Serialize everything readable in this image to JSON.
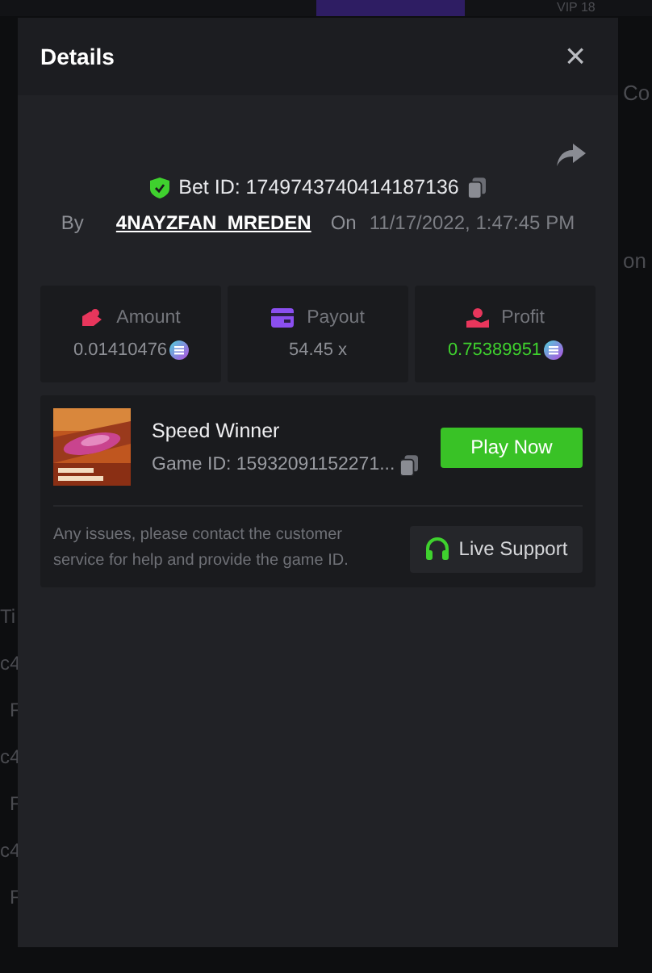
{
  "background": {
    "top_texts": [
      "VIP 18"
    ],
    "right_texts": [
      "Co",
      "on"
    ],
    "left_texts": [
      "Ti",
      "c4",
      "F",
      "c4",
      "F",
      "c4",
      "F"
    ]
  },
  "dialog": {
    "title": "Details",
    "close": "×"
  },
  "bet": {
    "bet_id": "Bet ID: 1749743740414187136",
    "by_label": "By",
    "user": "4NAYZFAN_MREDEN",
    "on_label": "On",
    "date": "11/17/2022, 1:47:45 PM"
  },
  "stats": [
    {
      "kind": "amount",
      "label": "Amount",
      "value": "0.01410476",
      "coin": true,
      "positive": false
    },
    {
      "kind": "payout",
      "label": "Payout",
      "value": "54.45 x",
      "coin": false,
      "positive": false
    },
    {
      "kind": "profit",
      "label": "Profit",
      "value": "0.75389951",
      "coin": true,
      "positive": true
    }
  ],
  "game": {
    "name": "Speed Winner",
    "game_id": "Game ID: 15932091152271...",
    "play_button": "Play Now"
  },
  "support": {
    "text": "Any issues, please contact the customer service for help and provide the game ID.",
    "button": "Live Support"
  }
}
